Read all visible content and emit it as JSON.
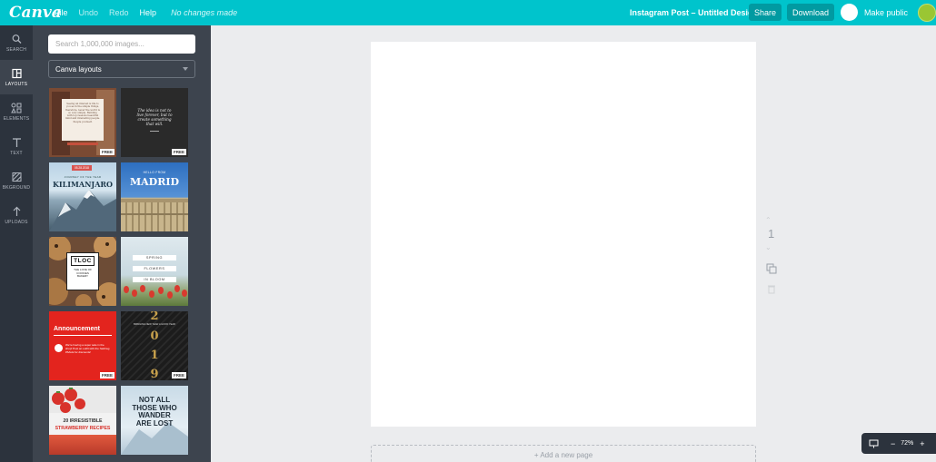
{
  "topbar": {
    "logo": "Canva",
    "menu": [
      {
        "label": "File"
      },
      {
        "label": "Undo"
      },
      {
        "label": "Redo"
      },
      {
        "label": "Help"
      }
    ],
    "status": "No changes made",
    "doc_title": "Instagram Post – Untitled Design",
    "share_label": "Share",
    "download_label": "Download",
    "public_label": "Make public",
    "accent_color": "#00c4cc"
  },
  "rail": {
    "items": [
      {
        "label": "SEARCH",
        "icon": "search-icon"
      },
      {
        "label": "LAYOUTS",
        "icon": "layouts-icon"
      },
      {
        "label": "ELEMENTS",
        "icon": "elements-icon"
      },
      {
        "label": "TEXT",
        "icon": "text-icon"
      },
      {
        "label": "BKGROUND",
        "icon": "background-icon"
      },
      {
        "label": "UPLOADS",
        "icon": "upload-icon"
      }
    ]
  },
  "panel": {
    "search_placeholder": "Search 1,000,000 images...",
    "selected_category": "Canva layouts",
    "free_badge": "FREE",
    "layouts": [
      {
        "text": "Seeing an interest is life to you as in the simple things, therefore, never the world is so very simple. Building with top reasons beautiful mind and interesting people. People yourself."
      },
      {
        "text": "The idea is not to live forever, but to create something that will."
      },
      {
        "date": "05.28.2018",
        "subtitle": "JOURNEY OF THE YEAR",
        "title": "KILIMANJARO"
      },
      {
        "subtitle": "HELLO FROM",
        "title": "MADRID"
      },
      {
        "title": "TLOC",
        "subtitle": "THE LOVE OF COOKIES BAKERY"
      },
      {
        "lines": [
          "SPRING",
          "FLOWERS",
          "IN BLOOM"
        ]
      },
      {
        "title": "Announcement",
        "text": "We're having a super sale in the shop! Post an outfit with the hashtag #SALE for discounts!"
      },
      {
        "digits": [
          "2",
          "0",
          "1",
          "9"
        ],
        "text": "BRINGING NEW YEAR A GOOD YEAR"
      },
      {
        "number": "20 IRRESISTIBLE",
        "title": "STRAWBERRY RECIPES"
      },
      {
        "lines": [
          "NOT ALL",
          "THOSE WHO",
          "WANDER",
          "ARE LOST"
        ]
      }
    ]
  },
  "canvas": {
    "page_number": "1",
    "add_page_label": "+ Add a new page"
  },
  "zoom": {
    "level": "72%",
    "minus": "−",
    "plus": "+"
  }
}
